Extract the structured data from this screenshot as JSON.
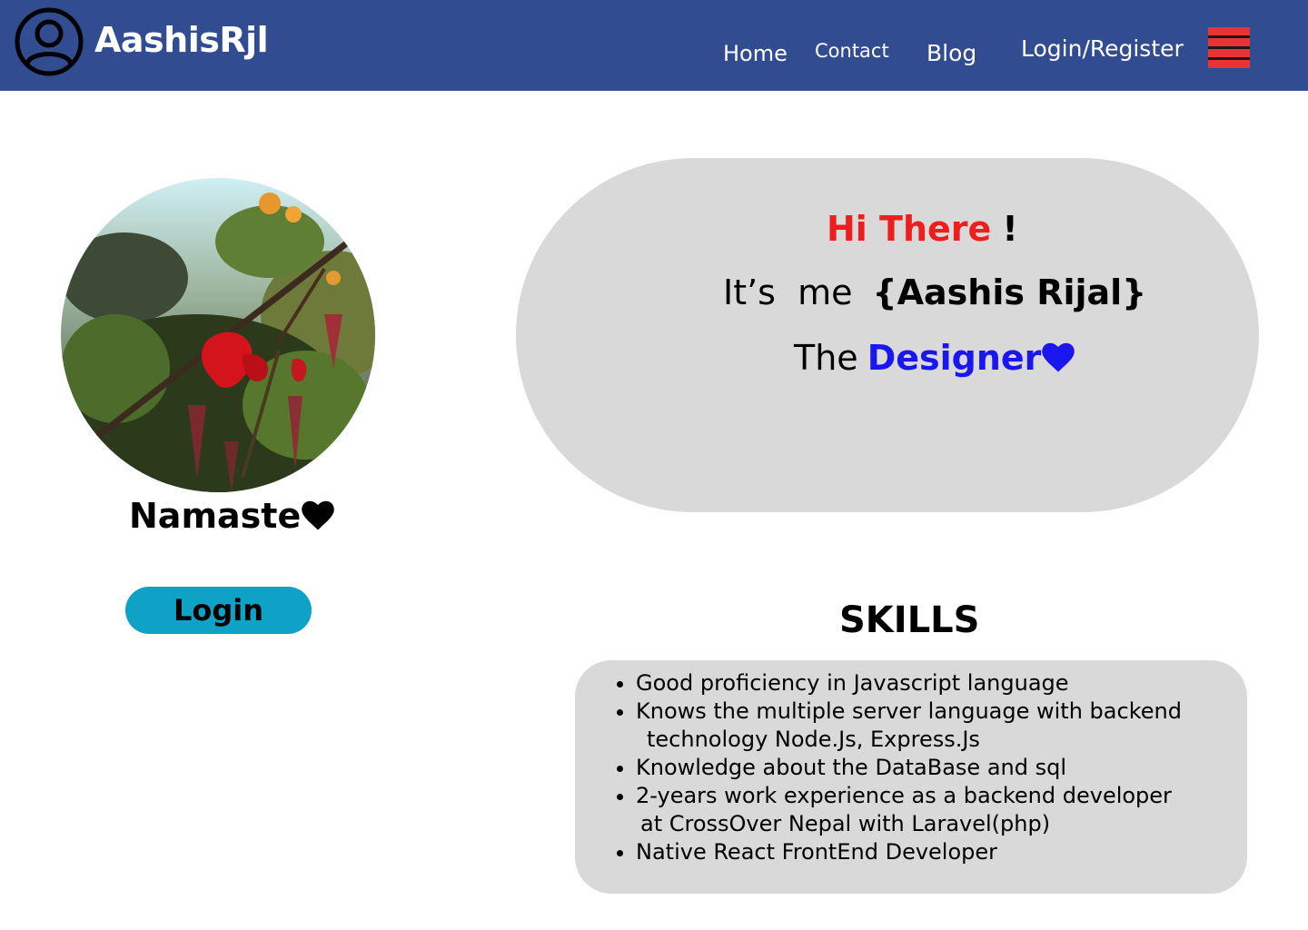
{
  "header": {
    "brand": "AashisRjl",
    "logo_icon": "user-circle-icon",
    "nav": {
      "home": "Home",
      "contact": "Contact",
      "blog": "Blog",
      "login_register": "Login/Register"
    },
    "menu_icon": "hamburger-menu-icon"
  },
  "profile": {
    "photo_alt": "flower-photo",
    "greeting": "Namaste",
    "login_label": "Login"
  },
  "hero": {
    "hi": "Hi There",
    "bang": "!",
    "its_me": "It’s  me",
    "name": "{Aashis Rijal}",
    "the": "The",
    "role": "Designer"
  },
  "skills": {
    "title": "SKILLS",
    "items": [
      {
        "line1": "Good proficiency in Javascript language",
        "line2": ""
      },
      {
        "line1": "Knows the multiple server language with backend",
        "line2": "technology Node.Js, Express.Js"
      },
      {
        "line1": "Knowledge about the DataBase and sql",
        "line2": ""
      },
      {
        "line1": "2-years work experience as a backend developer",
        "line2": "at CrossOver Nepal with Laravel(php)"
      },
      {
        "line1": "Native React FrontEnd Developer",
        "line2": ""
      }
    ]
  },
  "colors": {
    "header_bg": "#324c92",
    "menu_red": "#ea3434",
    "login_btn": "#0ea2c7",
    "card_gray": "#d9d9d9",
    "accent_red": "#f01d1d",
    "accent_blue": "#1a16ee"
  }
}
